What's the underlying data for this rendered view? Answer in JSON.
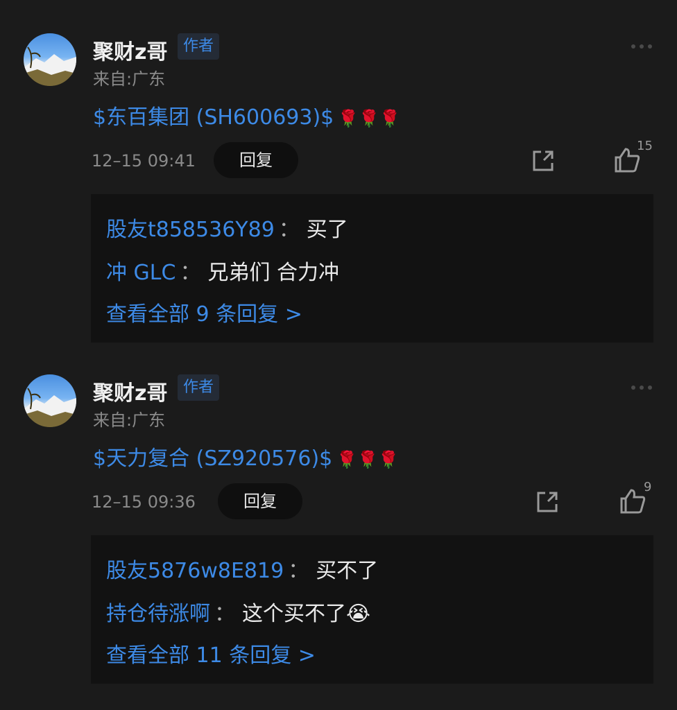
{
  "comments": [
    {
      "author": "聚财z哥",
      "badge": "作者",
      "location": "来自:广东",
      "content": "$东百集团 (SH600693)$",
      "emojis": "🌹🌹🌹",
      "time": "12–15 09:41",
      "reply_label": "回复",
      "likes": "15",
      "replies": [
        {
          "user": "股友t858536Y89",
          "sep": "：",
          "text": "买了"
        },
        {
          "user": "冲 GLC",
          "sep": "：",
          "text": "兄弟们  合力冲"
        }
      ],
      "view_all": "查看全部 9 条回复 >"
    },
    {
      "author": "聚财z哥",
      "badge": "作者",
      "location": "来自:广东",
      "content": "$天力复合 (SZ920576)$",
      "emojis": "🌹🌹🌹",
      "time": "12–15 09:36",
      "reply_label": "回复",
      "likes": "9",
      "replies": [
        {
          "user": "股友5876w8E819",
          "sep": "：",
          "text": "买不了"
        },
        {
          "user": "持仓待涨啊",
          "sep": "：",
          "text": "这个买不了😭"
        }
      ],
      "view_all": "查看全部 11 条回复 >"
    }
  ],
  "colors": {
    "background": "#1b1b1b",
    "link": "#3d8ae6",
    "reply_box": "#121212",
    "muted_text": "#8a8a8a"
  }
}
